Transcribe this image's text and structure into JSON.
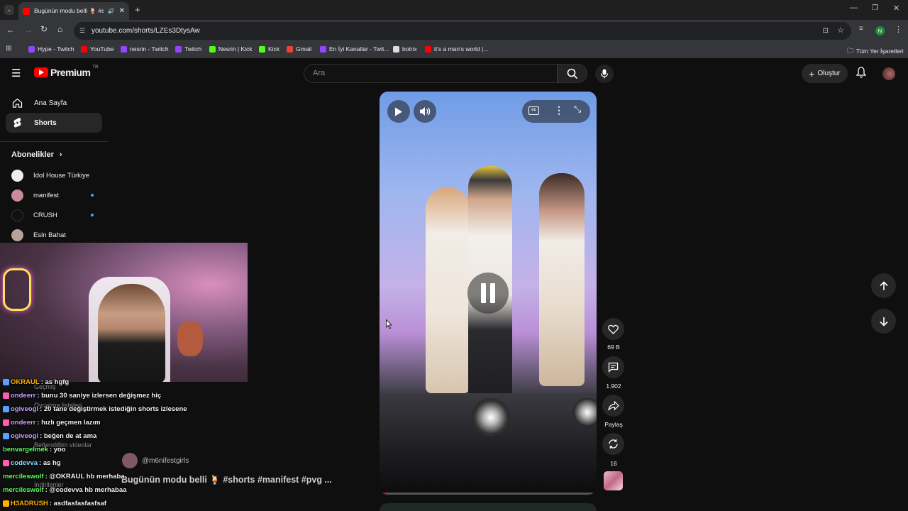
{
  "browser": {
    "tab_title": "Bugünün modu belli 🍹 #sh",
    "url": "youtube.com/shorts/LZEs3DtysAw",
    "profile_initial": "N",
    "bookmarks": [
      {
        "label": "Hype - Twitch",
        "color": "#9146ff"
      },
      {
        "label": "YouTube",
        "color": "#ff0000"
      },
      {
        "label": "nesrin - Twitch",
        "color": "#9146ff"
      },
      {
        "label": "Twitch",
        "color": "#9146ff"
      },
      {
        "label": "Nesrin | Kick",
        "color": "#53fc18"
      },
      {
        "label": "Kick",
        "color": "#53fc18"
      },
      {
        "label": "Gmail",
        "color": "#ea4335"
      },
      {
        "label": "En İyi Kanallar - Twit...",
        "color": "#9146ff"
      },
      {
        "label": "botrix",
        "color": "#dddddd"
      },
      {
        "label": "it's a man's world |...",
        "color": "#ff0000"
      }
    ],
    "all_bookmarks": "Tüm Yer İşaretleri"
  },
  "youtube": {
    "logo_text": "Premium",
    "region": "TR",
    "search_placeholder": "Ara",
    "create_label": "Oluştur",
    "sidebar": {
      "home": "Ana Sayfa",
      "shorts": "Shorts",
      "subscriptions_header": "Abonelikler",
      "subscriptions": [
        {
          "name": "Idol House Türkiye",
          "color": "#eeeeee",
          "new": false
        },
        {
          "name": "manifest",
          "color": "#c98a9a",
          "new": true
        },
        {
          "name": "CRUSH",
          "color": "#111111",
          "new": true
        },
        {
          "name": "Esin Bahat",
          "color": "#b8a39a",
          "new": false
        }
      ]
    },
    "short": {
      "channel": "@m6nifestgirls",
      "title": "Bugünün modu belli 🍹 #shorts #manifest #pvg ...",
      "likes": "69 B",
      "comments": "1.902",
      "share": "Paylaş",
      "remix": "16"
    }
  },
  "chat": [
    {
      "user": "OKRAUL",
      "msg": ": as hgfg",
      "color": "#ffb000",
      "badge": "#5aa0ff"
    },
    {
      "user": "ondeerr",
      "msg": ": bunu 30 saniye izlersen değişmez hiç",
      "color": "#c8a0ff",
      "badge": "#ff5ab4"
    },
    {
      "user": "ogiveogi",
      "msg": ": 20 tane değiştirmek istediğin shorts izlesene",
      "color": "#c8a0ff",
      "badge": "#5aa0ff"
    },
    {
      "user": "ondeerr",
      "msg": ": hızlı geçmen lazım",
      "color": "#c8a0ff",
      "badge": "#ff5ab4"
    },
    {
      "user": "ogiveogi",
      "msg": ": beğen de at ama",
      "color": "#c8a0ff",
      "badge": "#5aa0ff"
    },
    {
      "user": "benvargelmek",
      "msg": ": yoo",
      "color": "#5cff5c",
      "badge": ""
    },
    {
      "user": "codevva",
      "msg": ": as hg",
      "color": "#7ee0ff",
      "badge": "#ff5ab4"
    },
    {
      "user": "mercileswolf",
      "msg": ": @OKRAUL hb merhaba",
      "color": "#5cff5c",
      "badge": ""
    },
    {
      "user": "mercileswolf",
      "msg": ": @codevva hb merhabaa",
      "color": "#5cff5c",
      "badge": ""
    },
    {
      "user": "H3ADRUSH",
      "msg": ": asdfasfasfasfsaf",
      "color": "#ffb000",
      "badge": "#ffb000"
    }
  ],
  "ghost_sidebar": [
    "Geçmiş",
    "Oynatma listeleri",
    "Beğendiğim videolar",
    "İndirilenler"
  ]
}
